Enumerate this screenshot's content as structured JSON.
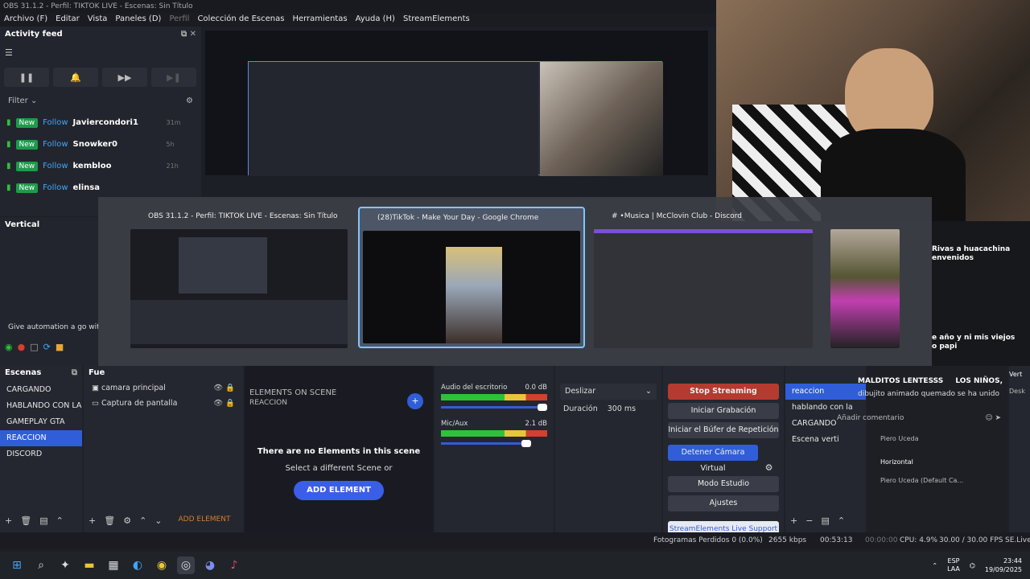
{
  "window_title": "OBS 31.1.2 - Perfil: TIKTOK LIVE - Escenas: Sin Título",
  "menu": [
    "Archivo (F)",
    "Editar",
    "Vista",
    "Paneles (D)",
    "Perfil",
    "Colección de Escenas",
    "Herramientas",
    "Ayuda (H)",
    "StreamElements"
  ],
  "activity": {
    "title": "Activity feed",
    "filter": "Filter",
    "new_label": "New",
    "follow_label": "Follow",
    "items": [
      {
        "name": "Javiercondori1",
        "time": "31m"
      },
      {
        "name": "Snowker0",
        "time": "5h"
      },
      {
        "name": "kembloo",
        "time": "21h"
      },
      {
        "name": "elinsa",
        "time": ""
      }
    ]
  },
  "vertical": {
    "title": "Vertical",
    "automation_text": "Give automation a go with th"
  },
  "switcher": {
    "windows": [
      {
        "title": "OBS 31.1.2 - Perfil: TIKTOK LIVE - Escenas: Sin Título"
      },
      {
        "title": "(28)TikTok - Make Your Day - Google Chrome"
      },
      {
        "title": "#  •Musica | McClovin Club - Discord"
      },
      {
        "title": ""
      }
    ]
  },
  "chat_right": {
    "lines": [
      "Rivas a huacachina",
      "envenidos",
      "e año y ni mis viejos",
      "o papi"
    ]
  },
  "scenes": {
    "title": "Escenas",
    "items": [
      "CARGANDO",
      "HABLANDO CON LA GEI",
      "GAMEPLAY GTA",
      "REACCION",
      "DISCORD"
    ],
    "selected": 3
  },
  "sources": {
    "title": "Fue",
    "items": [
      "camara principal",
      "Captura de pantalla"
    ],
    "add_element": "ADD ELEMENT"
  },
  "elements": {
    "title": "ELEMENTS ON SCENE",
    "subtitle": "REACCION",
    "empty": "There are no Elements in this scene",
    "hint": "Select a different Scene or",
    "add_button": "ADD ELEMENT"
  },
  "mixer": {
    "channels": [
      {
        "name": "Audio del escritorio",
        "db": "0.0 dB",
        "level": 0.8
      },
      {
        "name": "Mic/Aux",
        "db": "2.1 dB",
        "level": 0.75
      }
    ]
  },
  "transition": {
    "type": "Deslizar",
    "duration_label": "Duración",
    "duration": "300 ms"
  },
  "controls": {
    "stop_streaming": "Stop Streaming",
    "start_recording": "Iniciar Grabación",
    "replay_buffer": "Iniciar el Búfer de Repetición",
    "virtual_camera": "Detener Cámara Virtual",
    "studio_mode": "Modo Estudio",
    "settings": "Ajustes",
    "se_support": "StreamElements Live Support"
  },
  "scene_list2": {
    "items": [
      "reaccion",
      "hablando con la",
      "CARGANDO",
      "Escena verti"
    ]
  },
  "chat_overlay": {
    "header": "MALDITOS LENTESSS",
    "header2": "LOS NIÑOS,",
    "msg1": "dibujito animado quemado",
    "msg2": "se ha unido",
    "placeholder": "Añadir comentario",
    "users": [
      "Piero Uceda",
      "Horizontal",
      "Piero Uceda (Default Ca..."
    ],
    "vert": "Vert",
    "desk": "Desk"
  },
  "status": {
    "dropped": "Fotogramas Perdidos 0 (0.0%)",
    "kbps": "2655 kbps",
    "live_time": "00:53:13",
    "rec_time": "00:00:00",
    "cpu": "CPU: 4.9%",
    "fps": "30.00 / 30.00 FPS",
    "selive": "SE.Live"
  },
  "taskbar": {
    "lang1": "ESP",
    "lang2": "LAA",
    "time": "23:44",
    "date": "19/09/2025"
  },
  "colors": {
    "accent": "#2f5ed8",
    "stop": "#b53a2f",
    "green": "#1e9a4b"
  }
}
